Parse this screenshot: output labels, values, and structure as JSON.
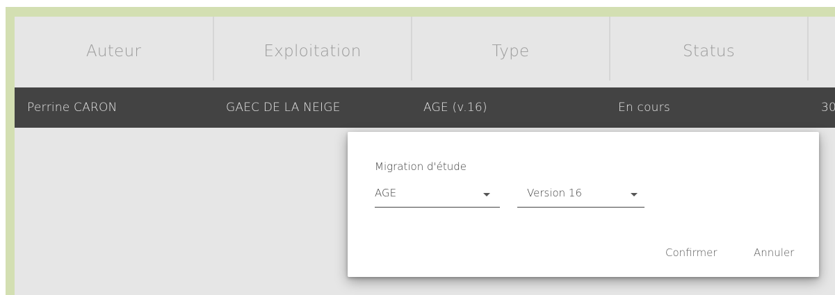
{
  "table": {
    "headers": [
      "Auteur",
      "Exploitation",
      "Type",
      "Status"
    ],
    "row": {
      "auteur": "Perrine CARON",
      "exploitation": "GAEC DE LA NEIGE",
      "type": "AGE (v.16)",
      "status": "En cours",
      "date_partial": "30"
    }
  },
  "dialog": {
    "title": "Migration d'étude",
    "type_select": {
      "value": "AGE"
    },
    "version_select": {
      "value": "Version 16"
    },
    "confirm_label": "Confirmer",
    "cancel_label": "Annuler"
  },
  "colors": {
    "frame": "#d3dfb2",
    "panel": "#e6e6e6",
    "selected_row": "#434343"
  }
}
